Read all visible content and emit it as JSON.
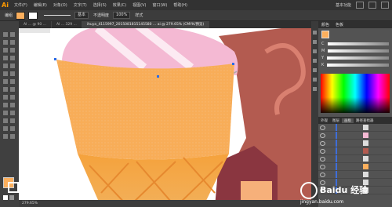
{
  "app": {
    "logo": "Ai"
  },
  "menubar": {
    "items": [
      "文件(F)",
      "编辑(E)",
      "对象(O)",
      "文字(T)",
      "选择(S)",
      "效果(C)",
      "视图(V)",
      "窗口(W)",
      "帮助(H)"
    ],
    "workspace": "基本功能"
  },
  "controlbar": {
    "label": "编组",
    "fill_color": "#fbaf5d",
    "stroke_style": "基本",
    "opacity_label": "不透明度",
    "opacity_value": "100%",
    "style_label": "样式"
  },
  "tabs": [
    "AI ... @ 90 ...",
    "AI ... 329 ...",
    "ihuya_4115997_2015081815145580 ... ai @ 279.65% (CMYK/预览)"
  ],
  "right_panel": {
    "tabs": [
      "颜色",
      "色板"
    ],
    "channels": [
      "C",
      "M",
      "Y",
      "K"
    ],
    "layers_tabs": [
      "外观",
      "图层",
      "画板",
      "路径查找器"
    ]
  },
  "status": {
    "zoom": "279.65%"
  },
  "watermark": {
    "brand": "Baidu 经验",
    "url": "jingyan.baidu.com"
  },
  "colors": {
    "cone_top": "#fbaf5d",
    "cone_body": "#f7a84d",
    "ice_cream": "#f4b9d3",
    "brown_shape": "#b35b50"
  }
}
